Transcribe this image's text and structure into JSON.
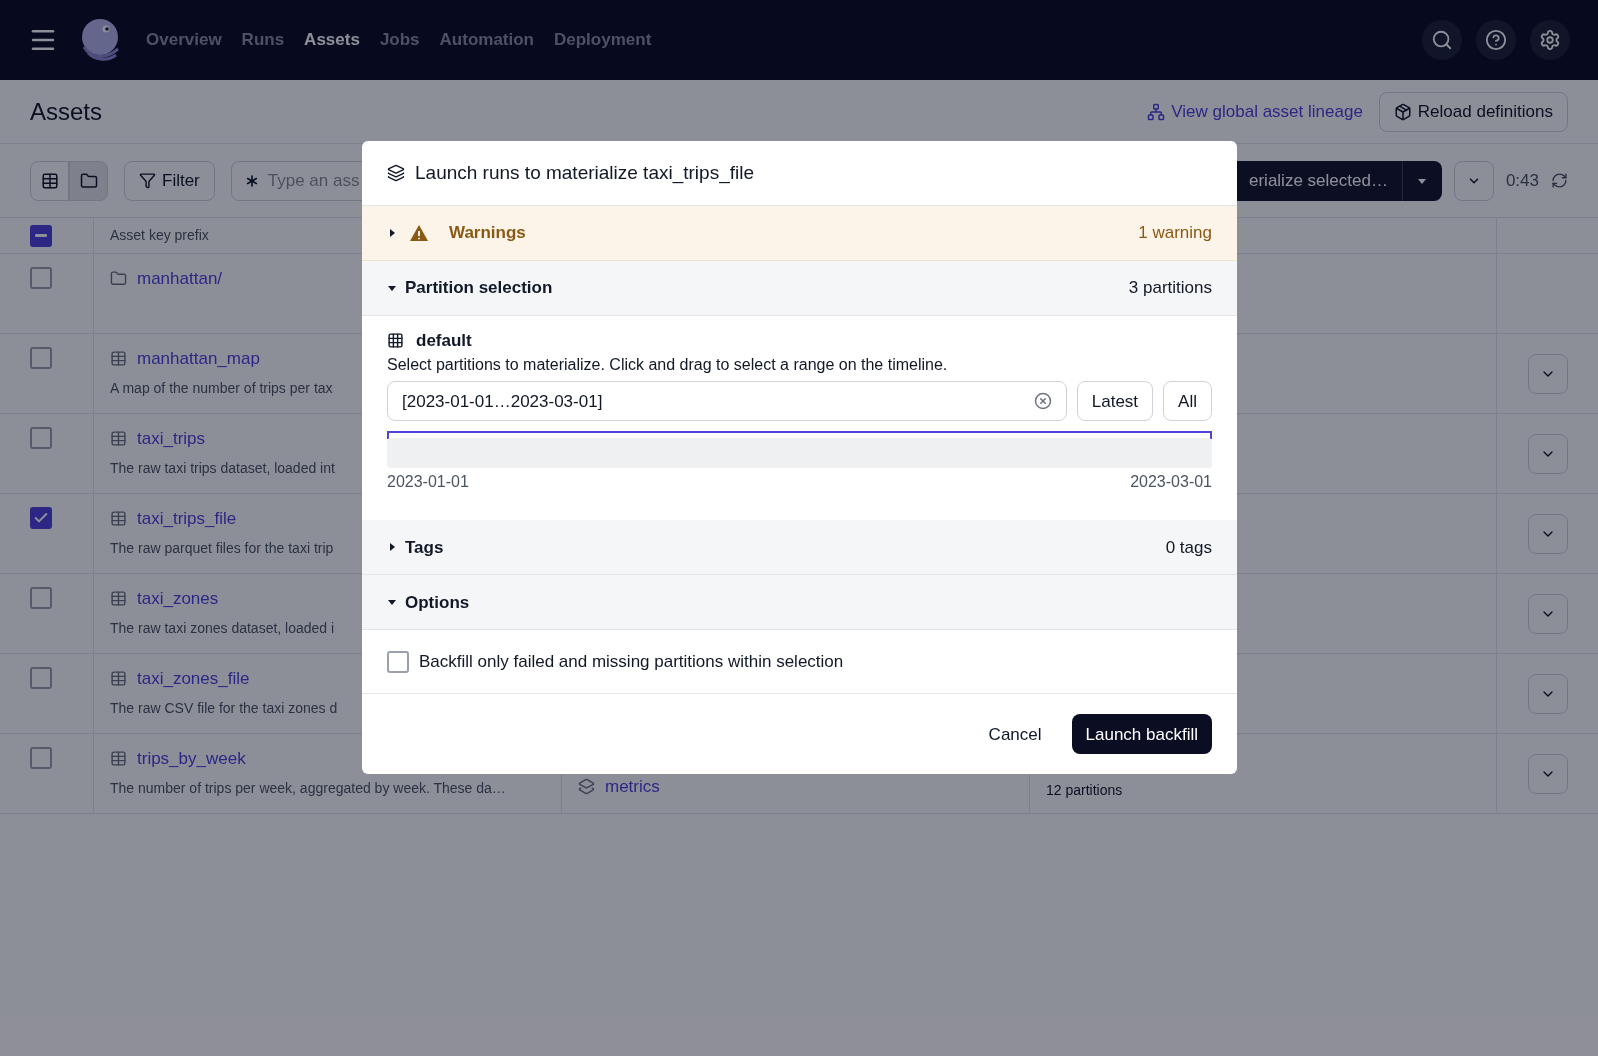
{
  "nav": {
    "links": [
      {
        "label": "Overview",
        "selected": false
      },
      {
        "label": "Runs",
        "selected": false
      },
      {
        "label": "Assets",
        "selected": true
      },
      {
        "label": "Jobs",
        "selected": false
      },
      {
        "label": "Automation",
        "selected": false
      },
      {
        "label": "Deployment",
        "selected": false
      }
    ]
  },
  "header": {
    "title": "Assets",
    "lineage_link": "View global asset lineage",
    "reload_button": "Reload definitions"
  },
  "toolbar": {
    "views": [
      {
        "kind": "table",
        "selected": false
      },
      {
        "kind": "folder",
        "selected": true
      }
    ],
    "filter_button": "Filter",
    "search": {
      "placeholder": "Type an ass"
    },
    "materialize_button": "erialize selected…",
    "timer": "0:43"
  },
  "table": {
    "select_all": {
      "indeterminate": true
    },
    "columns": [
      "Asset key prefix"
    ],
    "rows": [
      {
        "kind": "folder",
        "name": "manhattan/",
        "checked": false
      },
      {
        "kind": "asset",
        "name": "manhattan_map",
        "description": "A map of the number of trips per tax",
        "checked": false
      },
      {
        "kind": "asset",
        "name": "taxi_trips",
        "description": "The raw taxi trips dataset, loaded int",
        "checked": false
      },
      {
        "kind": "asset",
        "name": "taxi_trips_file",
        "description": "The raw parquet files for the taxi trip",
        "checked": true
      },
      {
        "kind": "asset",
        "name": "taxi_zones",
        "description": "The raw taxi zones dataset, loaded i",
        "checked": false
      },
      {
        "kind": "asset",
        "name": "taxi_zones_file",
        "description": "The raw CSV file for the taxi zones d",
        "checked": false
      },
      {
        "kind": "asset",
        "name": "trips_by_week",
        "description": "The number of trips per week, aggregated by week. These da…",
        "checked": false,
        "group": "metrics",
        "partitions": "12 partitions"
      }
    ]
  },
  "dialog": {
    "title": "Launch runs to materialize taxi_trips_file",
    "sections": [
      {
        "kind": "warnings",
        "label": "Warnings",
        "count": "1 warning",
        "expanded": false
      },
      {
        "kind": "partitions",
        "label": "Partition selection",
        "count": "3 partitions",
        "expanded": true,
        "partition_set": "default",
        "instructions": "Select partitions to materialize. Click and drag to select a range on the timeline.",
        "range": "[2023-01-01…2023-03-01]",
        "buttons": [
          "Latest",
          "All"
        ],
        "start": "2023-01-01",
        "end": "2023-03-01"
      },
      {
        "kind": "tags",
        "label": "Tags",
        "count": "0 tags",
        "expanded": false
      },
      {
        "kind": "options",
        "label": "Options",
        "expanded": true,
        "option": {
          "label": "Backfill only failed and missing partitions within selection",
          "checked": false
        }
      }
    ],
    "cancel_button": "Cancel",
    "launch_button": "Launch backfill"
  }
}
